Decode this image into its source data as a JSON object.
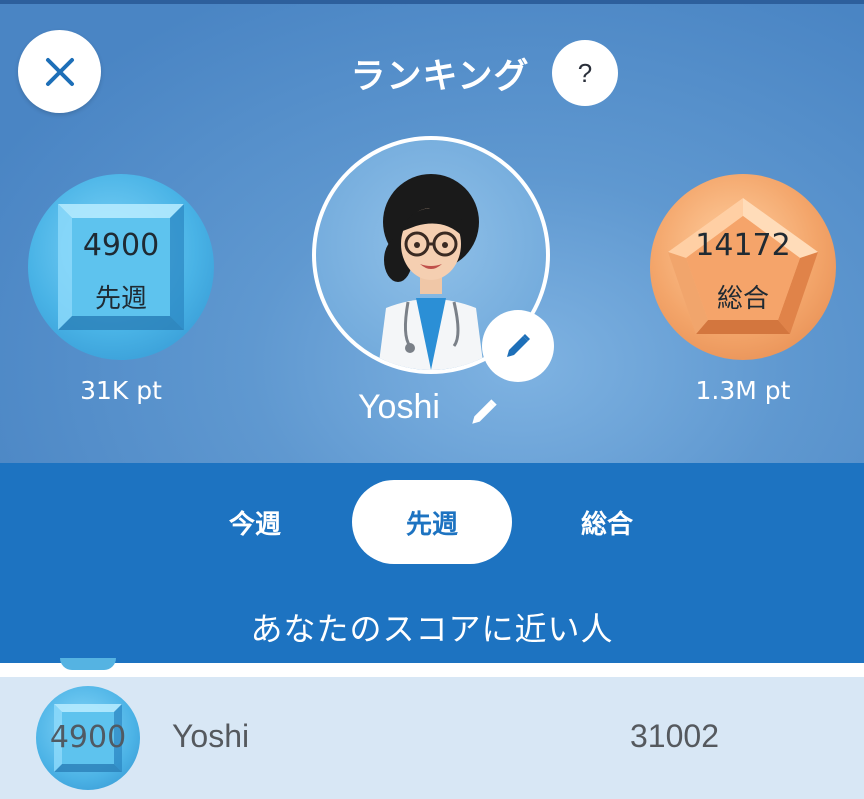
{
  "header": {
    "title": "ランキング",
    "help_label": "?",
    "username": "Yoshi"
  },
  "badges": {
    "weekly": {
      "rank": "4900",
      "label": "先週",
      "points": "31K pt",
      "color": "#49b3e6"
    },
    "overall": {
      "rank": "14172",
      "label": "総合",
      "points": "1.3M pt",
      "color": "#f3a56a"
    }
  },
  "tabs": [
    {
      "label": "今週",
      "selected": false
    },
    {
      "label": "先週",
      "selected": true
    },
    {
      "label": "総合",
      "selected": false
    }
  ],
  "section": {
    "title": "あなたのスコアに近い人"
  },
  "list": [
    {
      "rank": "4900",
      "name": "Yoshi",
      "score": "31002",
      "highlighted": true
    }
  ],
  "colors": {
    "tab_bar": "#1d73c1",
    "highlight_row": "#d8e7f5",
    "accent": "#1d73c1"
  },
  "icons": {
    "close": "close-icon",
    "help": "question-icon",
    "edit": "pencil-icon"
  }
}
